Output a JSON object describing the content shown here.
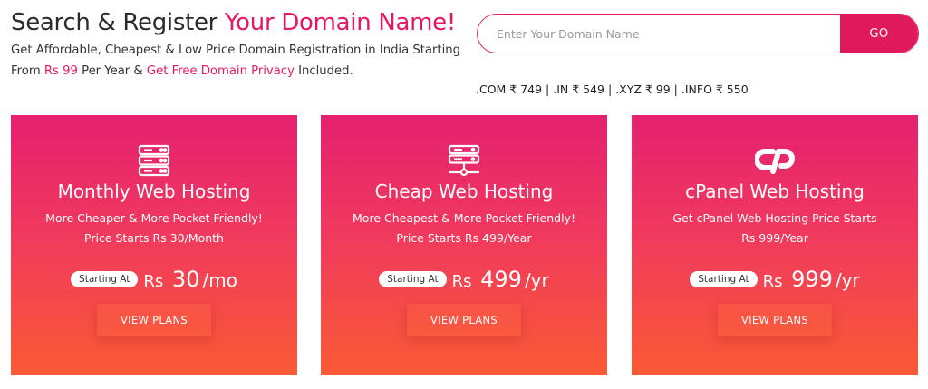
{
  "hero": {
    "title_prefix": "Search & Register ",
    "title_accent": "Your Domain Name!",
    "sub_1": "Get Affordable, Cheapest & Low Price Domain Registration in India Starting",
    "sub_2_a": "From ",
    "sub_2_price": "Rs 99",
    "sub_2_b": " Per Year & ",
    "sub_2_privacy": "Get Free Domain Privacy",
    "sub_2_c": " Included."
  },
  "search": {
    "placeholder": "Enter Your Domain Name",
    "value": "",
    "go_label": "GO"
  },
  "tld_prices": ".COM ₹ 749 | .IN ₹ 549 | .XYZ ₹ 99 | .INFO ₹ 550",
  "cards": [
    {
      "icon": "server-stack-icon",
      "title": "Monthly Web Hosting",
      "desc_1": "More Cheaper & More Pocket Friendly!",
      "desc_2": "Price Starts Rs 30/Month",
      "badge": "Starting At",
      "currency": "Rs",
      "amount": "30",
      "period": "/mo",
      "button": "VIEW PLANS"
    },
    {
      "icon": "server-network-icon",
      "title": "Cheap Web Hosting",
      "desc_1": "More Cheapest & More Pocket Friendly!",
      "desc_2": "Price Starts Rs 499/Year",
      "badge": "Starting At",
      "currency": "Rs",
      "amount": "499",
      "period": "/yr",
      "button": "VIEW PLANS"
    },
    {
      "icon": "cpanel-logo-icon",
      "title": "cPanel Web Hosting",
      "desc_1": "Get cPanel Web Hosting Price Starts",
      "desc_2": "Rs 999/Year",
      "badge": "Starting At",
      "currency": "Rs",
      "amount": "999",
      "period": "/yr",
      "button": "VIEW PLANS"
    }
  ],
  "colors": {
    "accent": "#e8185f",
    "card_top": "#e5206f",
    "card_bottom": "#fa5a35"
  }
}
